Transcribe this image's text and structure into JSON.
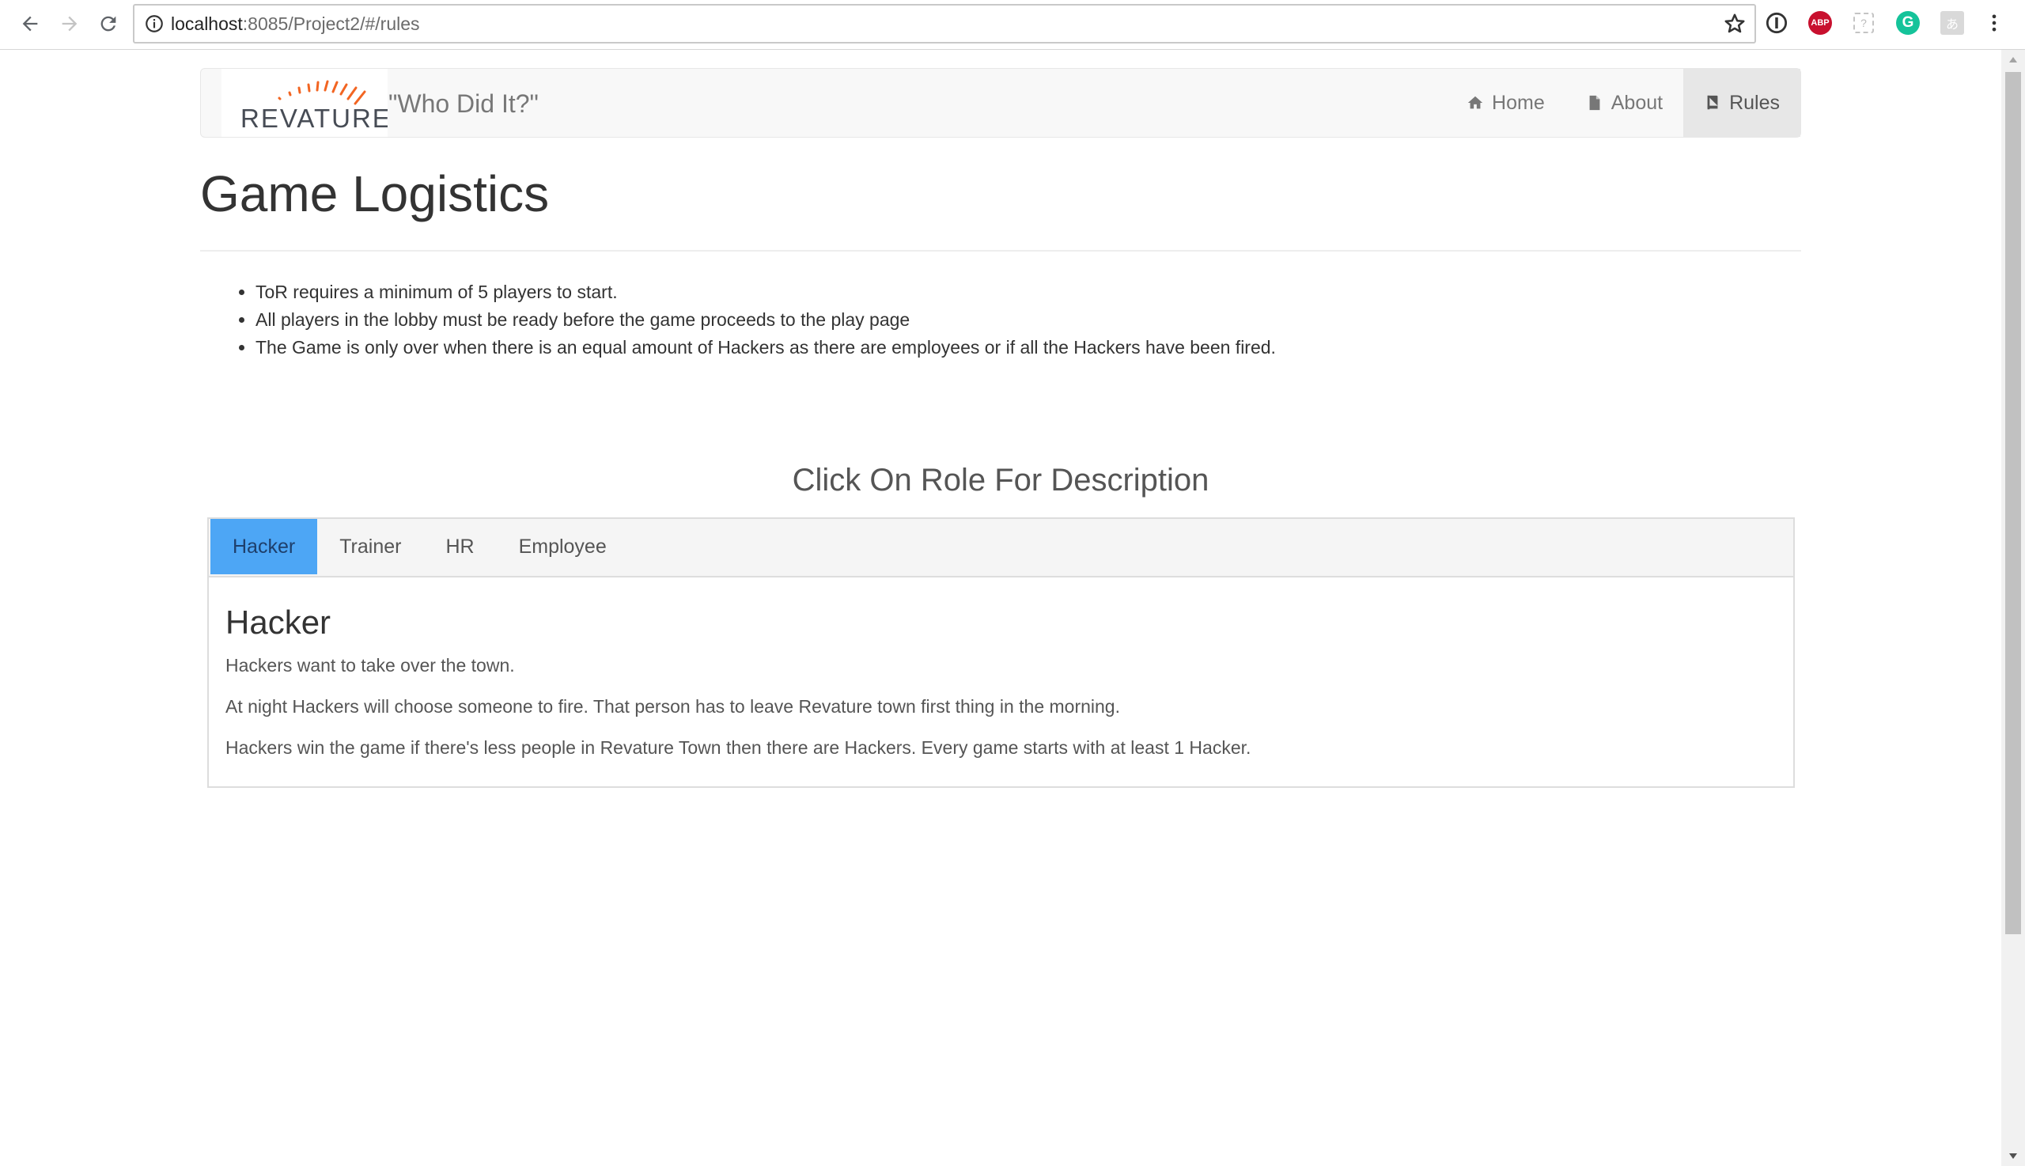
{
  "browser": {
    "url_host": "localhost",
    "url_rest": ":8085/Project2/#/rules",
    "extensions": [
      "info-icon",
      "abp-icon",
      "frame-icon",
      "grammarly-icon",
      "translate-icon"
    ]
  },
  "navbar": {
    "logo_text": "REVATURE",
    "brand_title": "\"Who Did It?\"",
    "links": [
      {
        "label": "Home",
        "icon": "home-icon"
      },
      {
        "label": "About",
        "icon": "file-icon"
      },
      {
        "label": "Rules",
        "icon": "book-icon",
        "active": true
      }
    ]
  },
  "page": {
    "title": "Game Logistics",
    "rules": [
      "ToR requires a minimum of 5 players to start.",
      "All players in the lobby must be ready before the game proceeds to the play page",
      "The Game is only over when there is an equal amount of Hackers as there are employees or if all the Hackers have been fired."
    ],
    "roles_heading": "Click On Role For Description"
  },
  "tabs": [
    "Hacker",
    "Trainer",
    "HR",
    "Employee"
  ],
  "active_tab": "Hacker",
  "panel": {
    "title": "Hacker",
    "paragraphs": [
      "Hackers want to take over the town.",
      "At night Hackers will choose someone to fire. That person has to leave Revature town first thing in the morning.",
      "Hackers win the game if there's less people in Revature Town then there are Hackers. Every game starts with at least 1 Hacker."
    ]
  },
  "colors": {
    "active_tab": "#4da6f5",
    "logo_accent": "#f26522",
    "navbar_bg": "#f8f8f8"
  }
}
